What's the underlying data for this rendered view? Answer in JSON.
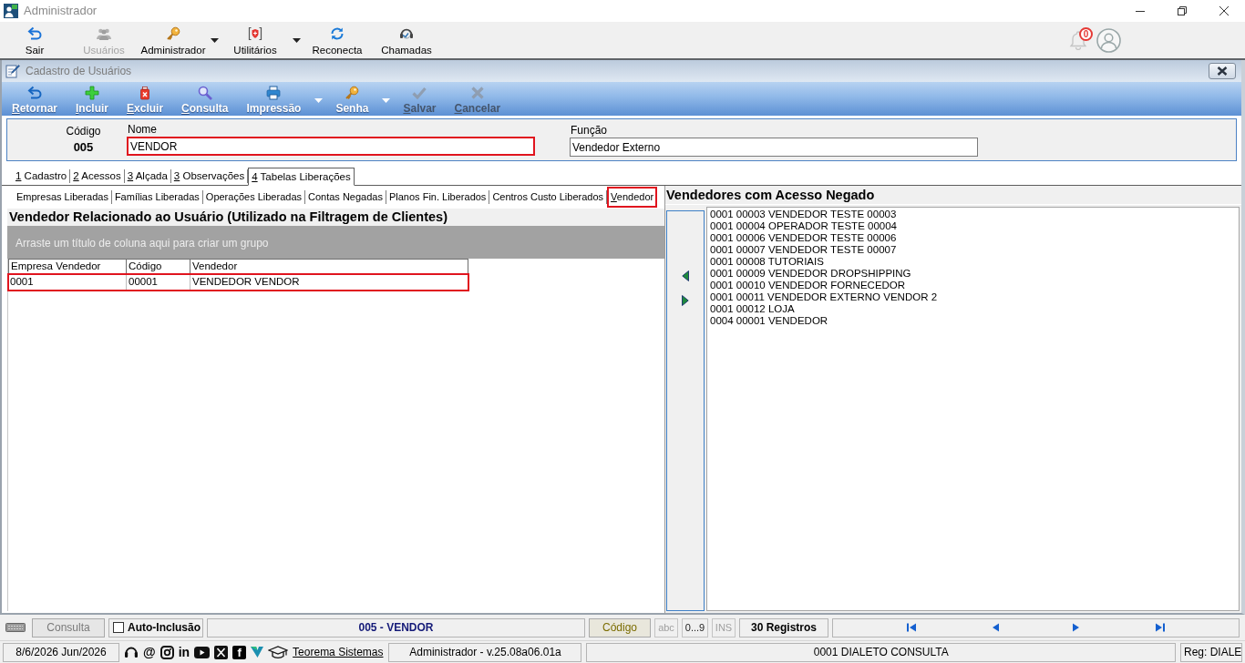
{
  "window": {
    "title": "Administrador"
  },
  "main_toolbar": {
    "buttons": [
      {
        "label": "Sair",
        "disabled": false,
        "dropdown": false
      },
      {
        "label": "Usuários",
        "disabled": true,
        "dropdown": false
      },
      {
        "label": "Administrador",
        "disabled": false,
        "dropdown": true
      },
      {
        "label": "Utilitários",
        "disabled": false,
        "dropdown": true
      },
      {
        "label": "Reconecta",
        "disabled": false,
        "dropdown": false
      },
      {
        "label": "Chamadas",
        "disabled": false,
        "dropdown": false
      }
    ],
    "notification_count": "0"
  },
  "form": {
    "title": "Cadastro de Usuários",
    "toolbar": [
      {
        "label": "Retornar",
        "disabled": false,
        "dropdown": false,
        "mnemonic_first": true
      },
      {
        "label": "Incluir",
        "disabled": false,
        "dropdown": false,
        "mnemonic_first": true
      },
      {
        "label": "Excluir",
        "disabled": false,
        "dropdown": false,
        "mnemonic_first": true
      },
      {
        "label": "Consulta",
        "disabled": false,
        "dropdown": false,
        "mnemonic_first": true
      },
      {
        "label": "Impressão",
        "disabled": false,
        "dropdown": true,
        "mnemonic_first": false
      },
      {
        "label": "Senha",
        "disabled": false,
        "dropdown": true,
        "mnemonic_first": false
      },
      {
        "label": "Salvar",
        "disabled": true,
        "dropdown": false,
        "mnemonic_first": true
      },
      {
        "label": "Cancelar",
        "disabled": true,
        "dropdown": false,
        "mnemonic_first": true
      }
    ],
    "code": {
      "label": "Código",
      "value": "005"
    },
    "fields": [
      {
        "label": "Nome",
        "value": "VENDOR",
        "highlighted": true
      },
      {
        "label": "Função",
        "value": "Vendedor Externo",
        "highlighted": false
      }
    ],
    "tabs": [
      {
        "label": "1 Cadastro",
        "selected": false
      },
      {
        "label": "2 Acessos",
        "selected": false
      },
      {
        "label": "3 Alçada",
        "selected": false
      },
      {
        "label": "3 Observações",
        "selected": false
      },
      {
        "label": "4 Tabelas Liberações",
        "selected": true
      }
    ],
    "subtabs": [
      {
        "label": "Empresas Liberadas",
        "selected": false,
        "highlighted": false
      },
      {
        "label": "Famílias Liberadas",
        "selected": false,
        "highlighted": false
      },
      {
        "label": "Operações Liberadas",
        "selected": false,
        "highlighted": false
      },
      {
        "label": "Contas Negadas",
        "selected": false,
        "highlighted": false
      },
      {
        "label": "Planos Fin. Liberados",
        "selected": false,
        "highlighted": false
      },
      {
        "label": "Centros Custo Liberados",
        "selected": false,
        "highlighted": false
      },
      {
        "label": "Vendedor",
        "selected": true,
        "highlighted": true
      }
    ]
  },
  "related_vendor": {
    "title": "Vendedor Relacionado ao Usuário (Utilizado na Filtragem de Clientes)",
    "group_hint": "Arraste um título de coluna aqui para criar um grupo",
    "table": {
      "columns": [
        "Empresa Vendedor",
        "Código",
        "Vendedor"
      ],
      "rows": [
        {
          "cells": [
            "0001",
            "00001",
            "VENDEDOR VENDOR"
          ],
          "highlighted": true
        }
      ]
    }
  },
  "denied_vendors": {
    "title": "Vendedores com Acesso Negado",
    "items": [
      "0001 00003 VENDEDOR TESTE 00003",
      "0001 00004 OPERADOR TESTE 00004",
      "0001 00006 VENDEDOR TESTE 00006",
      "0001 00007 VENDEDOR TESTE 00007",
      "0001 00008 TUTORIAIS",
      "0001 00009 VENDEDOR DROPSHIPPING",
      "0001 00010 VENDEDOR FORNECEDOR",
      "0001 00011 VENDEDOR EXTERNO VENDOR 2",
      "0001 00012 LOJA",
      "0004 00001 VENDEDOR"
    ]
  },
  "status_bar": {
    "mode_button": "Consulta",
    "auto_inclusion": {
      "label": "Auto-Inclusão",
      "checked": false
    },
    "record": "005 - VENDOR",
    "sort_button": "Código",
    "indicators": [
      {
        "label": "abc",
        "active": false
      },
      {
        "label": "0...9",
        "active": true
      },
      {
        "label": "INS",
        "active": false
      }
    ],
    "count": "30 Registros"
  },
  "footer": {
    "date": "8/6/2026 Jun/2026",
    "glyphs": [
      "@",
      "in",
      "f"
    ],
    "link": "Teorema Sistemas",
    "version": "Administrador - v.25.08a06.01a",
    "company": "0001 DIALETO CONSULTA",
    "registration": "Reg: DIALE"
  }
}
